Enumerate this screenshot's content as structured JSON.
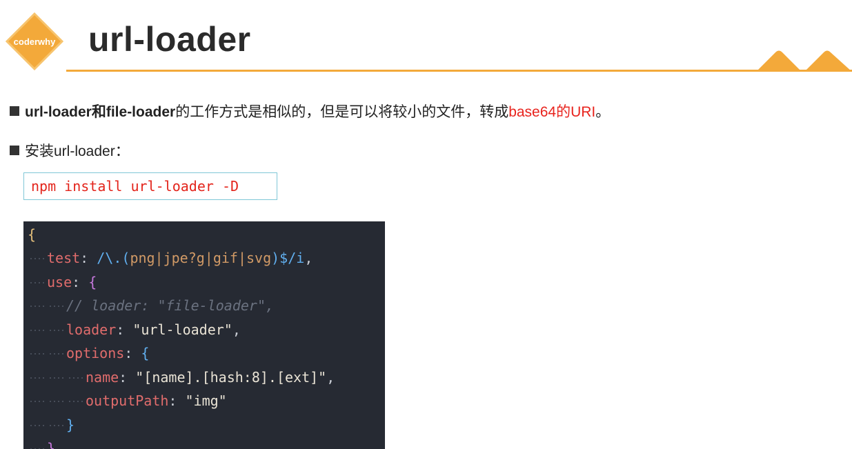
{
  "slide": {
    "logo_text": "coderwhy",
    "title": "url-loader"
  },
  "bullets": {
    "b1": {
      "part1": "url-loader和file-loader",
      "part2": "的工作方式是相似的，但是可以将较小的文件，转成",
      "part3": "base64的URI",
      "part4": "。"
    },
    "b2": "安装url-loader："
  },
  "command": "npm install url-loader -D",
  "code": {
    "open_brace": "{",
    "test_key": "test",
    "test_regex_prefix": "/\\.(",
    "test_regex_body": "png|jpe?g|gif|svg",
    "test_regex_suffix": ")$/i",
    "use_key": "use",
    "comment": "// loader: \"file-loader\",",
    "loader_key": "loader",
    "loader_value": "\"url-loader\"",
    "options_key": "options",
    "name_key": "name",
    "name_value": "\"[name].[hash:8].[ext]\"",
    "outputPath_key": "outputPath",
    "outputPath_value": "\"img\"",
    "close_brace": "}"
  },
  "colors": {
    "accent": "#f3a93a",
    "highlight_red": "#e8231d",
    "code_bg": "#262a33"
  }
}
